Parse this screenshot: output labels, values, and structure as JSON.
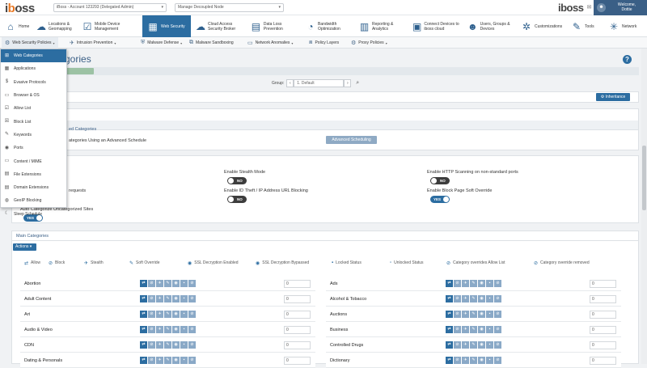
{
  "topbar": {
    "logo_main": "i",
    "logo_b": "b",
    "logo_rest": "oss",
    "account_select": "iBoss - Account 123293 (Delegated Admin)",
    "node_select": "Manage Decoupled Node",
    "brand_right": "iboss",
    "welcome_line1": "Welcome,",
    "welcome_line2": "Dottie"
  },
  "mainnav": [
    {
      "label": "Home",
      "icon": "home-icon",
      "glyph": "⌂"
    },
    {
      "label": "Locations & Geomapping",
      "icon": "cloud-icon",
      "glyph": "☁"
    },
    {
      "label": "Mobile Device Management",
      "icon": "checkbox-icon",
      "glyph": "☑"
    },
    {
      "label": "Web Security",
      "icon": "web-icon",
      "glyph": "▦"
    },
    {
      "label": "Cloud Access Security Broker",
      "icon": "cloud-lock-icon",
      "glyph": "☁"
    },
    {
      "label": "Data Loss Prevention",
      "icon": "document-icon",
      "glyph": "▤"
    },
    {
      "label": "Bandwidth Optimization",
      "icon": "speed-icon",
      "glyph": "◔"
    },
    {
      "label": "Reporting & Analytics",
      "icon": "chart-icon",
      "glyph": "▥"
    },
    {
      "label": "Connect Devices to iboss cloud",
      "icon": "devices-icon",
      "glyph": "▣"
    },
    {
      "label": "Users, Groups & Devices",
      "icon": "users-icon",
      "glyph": "☻"
    },
    {
      "label": "Customizations",
      "icon": "gear-icon",
      "glyph": "✲"
    },
    {
      "label": "Tools",
      "icon": "wrench-icon",
      "glyph": "✎"
    },
    {
      "label": "Network",
      "icon": "network-icon",
      "glyph": "✳"
    }
  ],
  "subnav": [
    {
      "label": "Web Security Policies",
      "glyph": "⚙"
    },
    {
      "label": "Intrusion Prevention",
      "glyph": "✈"
    },
    {
      "label": "Malware Defense",
      "glyph": "⛨"
    },
    {
      "label": "Malware Sandboxing",
      "glyph": "⧉"
    },
    {
      "label": "Network Anomalies",
      "glyph": "▭"
    },
    {
      "label": "Policy Layers",
      "glyph": "⧈"
    },
    {
      "label": "Proxy Policies",
      "glyph": "⚙"
    }
  ],
  "dropdown": [
    {
      "label": "Web Categories",
      "glyph": "⊞"
    },
    {
      "label": "Applications",
      "glyph": "▦"
    },
    {
      "label": "Evasive Protocols",
      "glyph": "$"
    },
    {
      "label": "Browser & OS",
      "glyph": "▭"
    },
    {
      "label": "Allow List",
      "glyph": "☑"
    },
    {
      "label": "Block List",
      "glyph": "☒"
    },
    {
      "label": "Keywords",
      "glyph": "✎"
    },
    {
      "label": "Ports",
      "glyph": "◉"
    },
    {
      "label": "Content / MIME",
      "glyph": "▭"
    },
    {
      "label": "File Extensions",
      "glyph": "▤"
    },
    {
      "label": "Domain Extensions",
      "glyph": "▤"
    },
    {
      "label": "GeoIP Blocking",
      "glyph": "◍"
    },
    {
      "label": "Sleep Schedule",
      "glyph": "☾"
    }
  ],
  "page": {
    "title_fragment": "tegories",
    "pager_label": "Group:",
    "pager_prev": "‹",
    "pager_value": "1. Default",
    "pager_next": "›",
    "search_glyph": "⌕",
    "inheritance_button": "⚙ Inheritance",
    "schedule_header": "ed Categories",
    "schedule_text": "ategories Using an Advanced Schedule",
    "advanced_button": "Advanced Scheduling"
  },
  "settings": {
    "stealth_label": "Enable Stealth Mode",
    "stealth_value": "NO",
    "https_label": "Enable HTTP Scanning on non-standard ports",
    "https_value": "NO",
    "requests_label": "requests",
    "theft_label": "Enable ID Theft / IP Address URL Blocking",
    "theft_value": "NO",
    "softoverride_label": "Enable Block Page Soft Override",
    "softoverride_value": "YES",
    "autocat_label": "Auto Categorize Uncategorized Sites",
    "autocat_value": "YES"
  },
  "main_categories": {
    "header": "Main Categories",
    "actions_label": "Actions ▾",
    "legend": [
      {
        "glyph": "⇄",
        "label": "Allow"
      },
      {
        "glyph": "⊘",
        "label": "Block"
      },
      {
        "glyph": "✈",
        "label": "Stealth"
      },
      {
        "glyph": "✎",
        "label": "Soft Override"
      },
      {
        "glyph": "◉",
        "label": "SSL Decryption Enabled"
      },
      {
        "glyph": "◉",
        "label": "SSL Decryption Bypassed"
      },
      {
        "glyph": "▪",
        "label": "Locked Status"
      },
      {
        "glyph": "▫",
        "label": "Unlocked Status"
      },
      {
        "glyph": "⊘",
        "label": "Category overrides Allow List"
      },
      {
        "glyph": "⊘",
        "label": "Category override removed"
      }
    ],
    "left": [
      {
        "name": "Abortion",
        "value": "0"
      },
      {
        "name": "Adult Content",
        "value": "0"
      },
      {
        "name": "Art",
        "value": "0"
      },
      {
        "name": "Audio & Video",
        "value": "0"
      },
      {
        "name": "CDN",
        "value": "0"
      },
      {
        "name": "Dating & Personals",
        "value": "0"
      }
    ],
    "right": [
      {
        "name": "Ads",
        "value": "0"
      },
      {
        "name": "Alcohol & Tobacco",
        "value": "0"
      },
      {
        "name": "Auctions",
        "value": "0"
      },
      {
        "name": "Business",
        "value": "0"
      },
      {
        "name": "Controlled Drugs",
        "value": "0"
      },
      {
        "name": "Dictionary",
        "value": "0"
      }
    ],
    "action_glyphs": [
      "⇄",
      "⊘",
      "✈",
      "✎",
      "◉",
      "▪",
      "⊘"
    ]
  }
}
